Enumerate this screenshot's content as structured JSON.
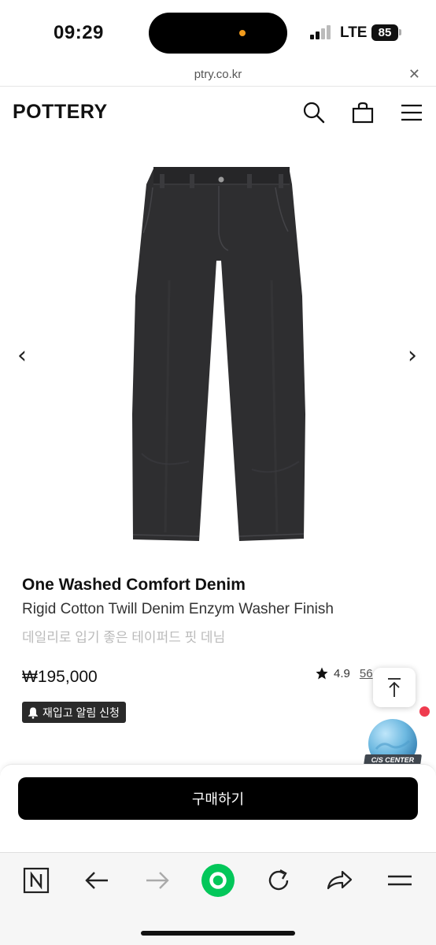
{
  "status_bar": {
    "time": "09:29",
    "network": "LTE",
    "battery": "85"
  },
  "browser": {
    "url": "ptry.co.kr",
    "close_label": "✕"
  },
  "header": {
    "logo": "POTTERY",
    "icons": [
      "search-icon",
      "shopping-bag-icon",
      "menu-icon"
    ]
  },
  "gallery": {
    "prev_label": "‹",
    "next_label": "›",
    "image_subject": "black wide denim jeans"
  },
  "product": {
    "name": "One Washed Comfort Denim",
    "subtitle": "Rigid Cotton Twill Denim Enzym Washer Finish",
    "description": "데일리로 입기 좋은 테이퍼드 핏 데님",
    "price": "₩195,000",
    "rating": "4.9",
    "review_count": "56",
    "restock_label": "재입고 알림 신청"
  },
  "floating": {
    "cs_label": "C/S CENTER"
  },
  "purchase": {
    "buy_label": "구매하기"
  },
  "toolbar": {
    "items": [
      "naver-icon",
      "back-icon",
      "forward-icon",
      "home-icon",
      "refresh-icon",
      "share-icon",
      "menu-icon"
    ],
    "active_color": "#03c75a"
  },
  "colors": {
    "accent": "#000000",
    "notification": "#ef3b4f",
    "naver_green": "#03c75a"
  }
}
